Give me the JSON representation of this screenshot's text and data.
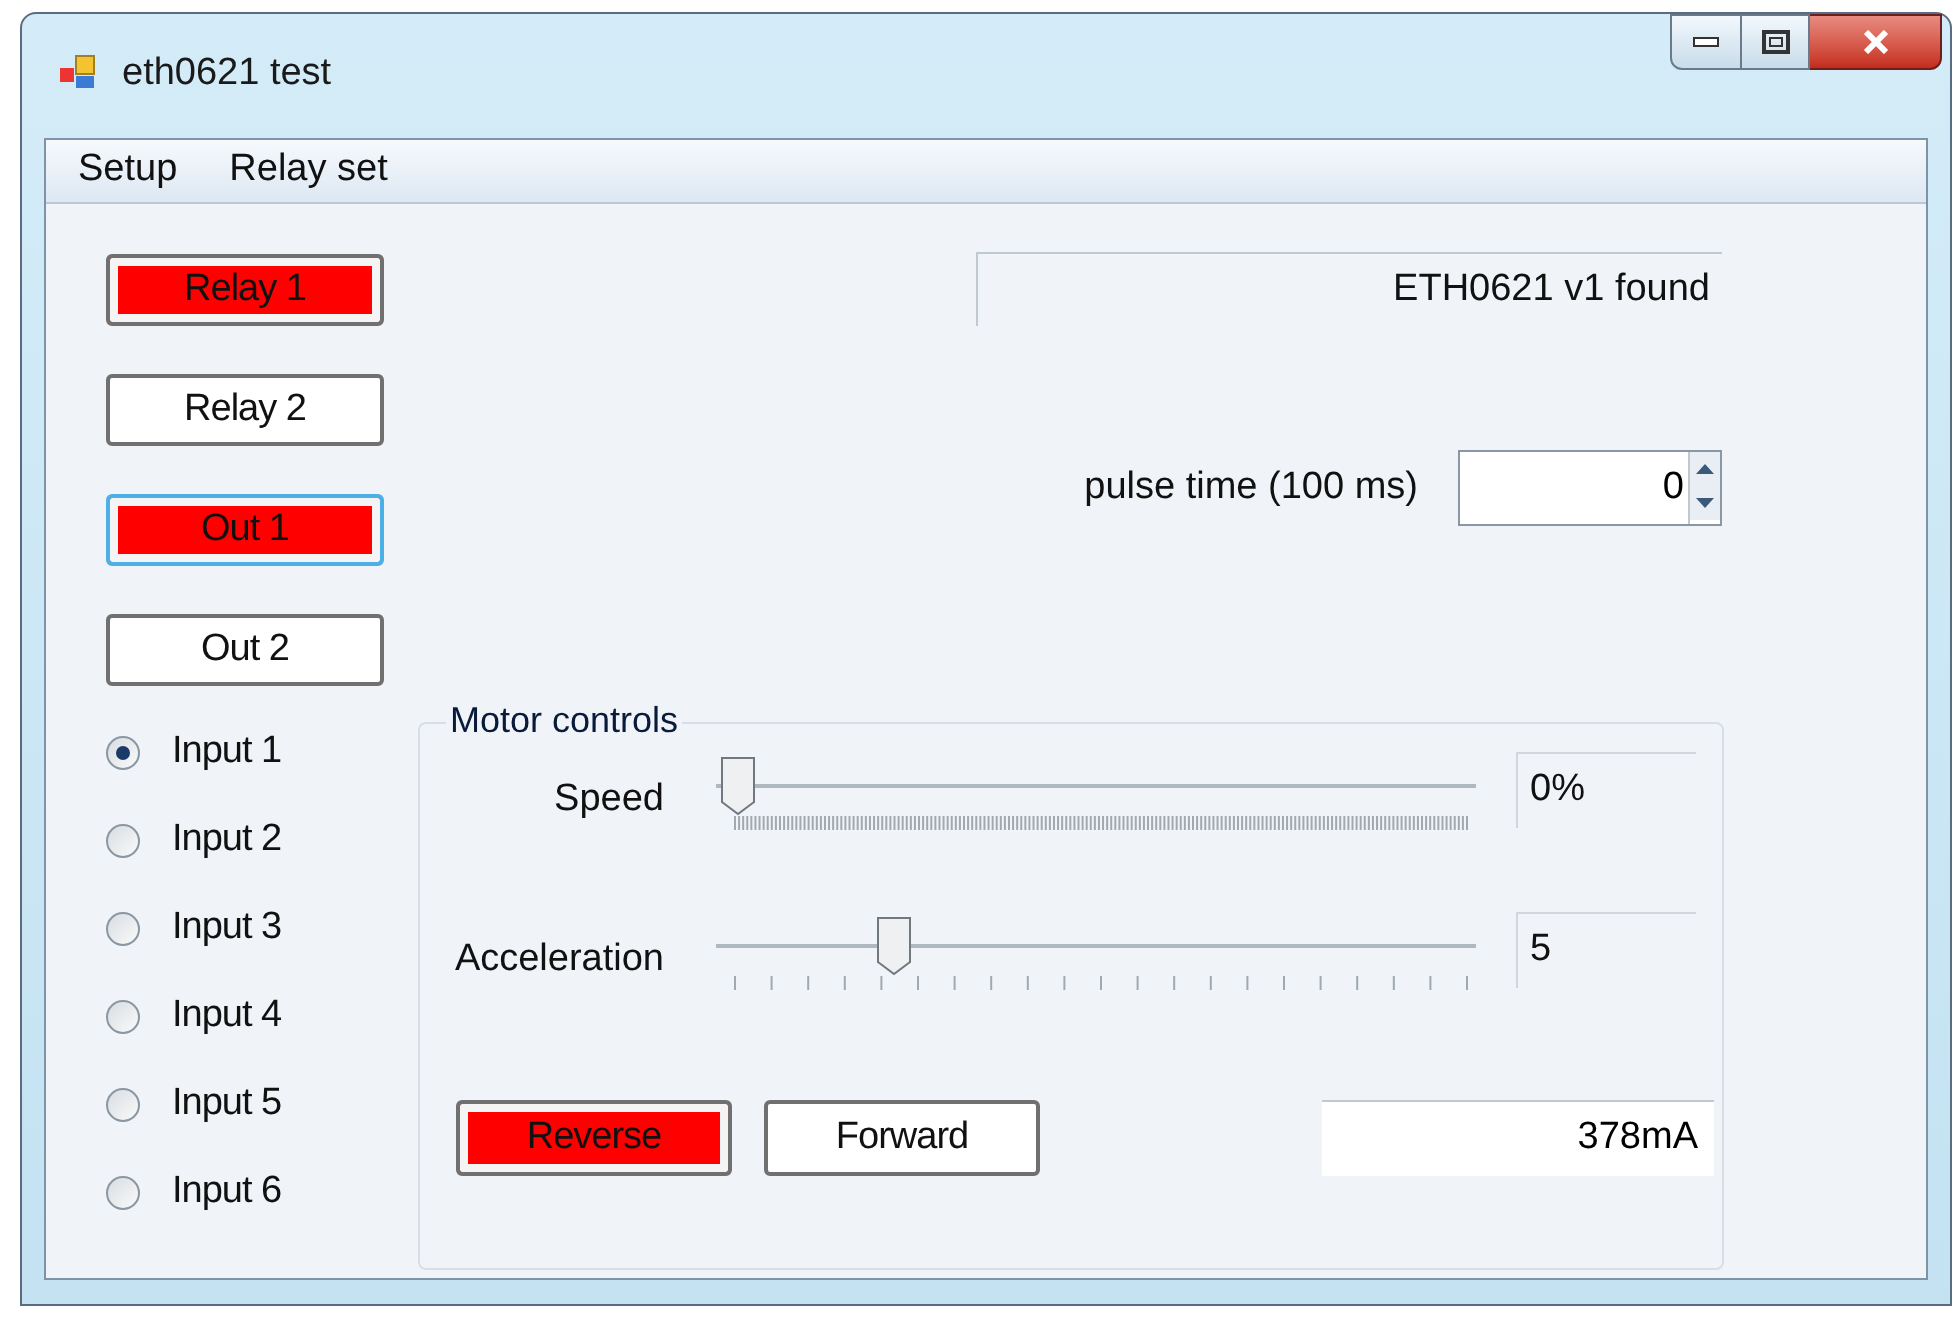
{
  "window": {
    "title": "eth0621 test"
  },
  "menu": [
    {
      "label": "Setup"
    },
    {
      "label": "Relay set"
    }
  ],
  "outputs": [
    {
      "label": "Relay 1",
      "on": true,
      "focused": false
    },
    {
      "label": "Relay 2",
      "on": false,
      "focused": false
    },
    {
      "label": "Out 1",
      "on": true,
      "focused": true
    },
    {
      "label": "Out 2",
      "on": false,
      "focused": false
    }
  ],
  "inputs": [
    {
      "label": "Input 1",
      "selected": true
    },
    {
      "label": "Input 2",
      "selected": false
    },
    {
      "label": "Input 3",
      "selected": false
    },
    {
      "label": "Input 4",
      "selected": false
    },
    {
      "label": "Input 5",
      "selected": false
    },
    {
      "label": "Input 6",
      "selected": false
    }
  ],
  "status": "ETH0621 v1 found",
  "pulse_time": {
    "label": "pulse time (100 ms)",
    "value": "0"
  },
  "motor_controls": {
    "title": "Motor controls",
    "sliders": [
      {
        "label": "Speed",
        "level": 0,
        "reading": "0%",
        "kind": "fine"
      },
      {
        "label": "Acceleration",
        "level": 0.22,
        "reading": "5",
        "kind": "coarse"
      }
    ],
    "direction_buttons": [
      {
        "label": "Reverse",
        "on": true
      },
      {
        "label": "Forward",
        "on": false
      }
    ],
    "current": "378mA"
  }
}
